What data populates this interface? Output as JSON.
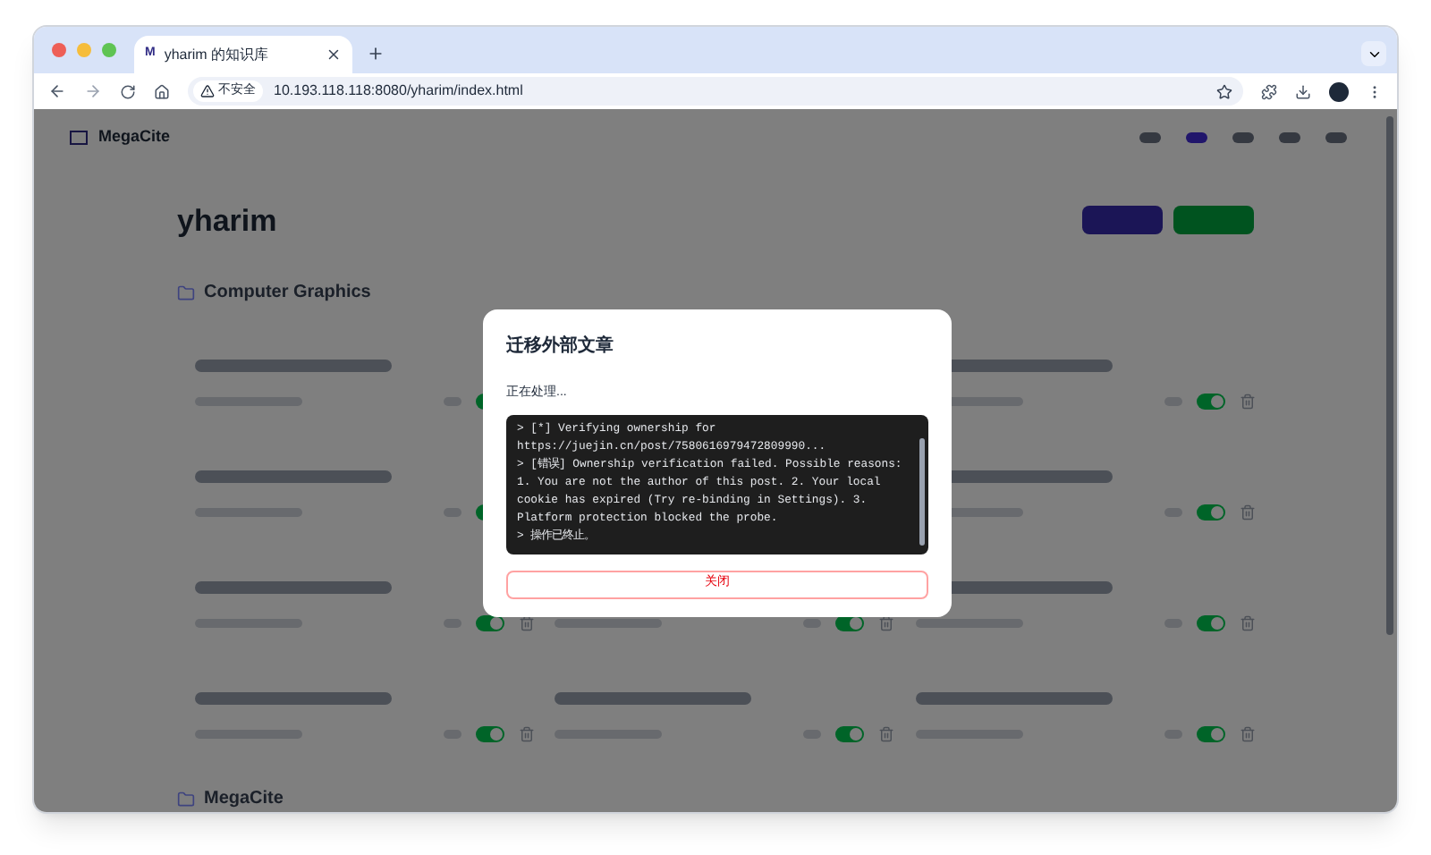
{
  "browser": {
    "tab_icon": "M",
    "tab_title": "yharim 的知识库",
    "security_label": "不安全",
    "url": "10.193.118.118:8080/yharim/index.html"
  },
  "page": {
    "logo": "MegaCite",
    "nav": [
      {
        "selected": false
      },
      {
        "selected": true
      },
      {
        "selected": false
      },
      {
        "selected": false
      },
      {
        "selected": false
      }
    ],
    "title": "yharim",
    "sections": [
      {
        "name": "Computer Graphics"
      },
      {
        "name": "MegaCite"
      }
    ],
    "cards": [
      {
        "on": true
      },
      {
        "on": true
      },
      {
        "on": true
      },
      {
        "on": true
      },
      {
        "on": true
      },
      {
        "on": true
      },
      {
        "on": true
      },
      {
        "on": true
      },
      {
        "on": true
      },
      {
        "on": true
      }
    ]
  },
  "dialog": {
    "title": "迁移外部文章",
    "status": "正在处理...",
    "log": [
      "> [*] Verifying ownership for https://juejin.cn/post/7580616979472809990...",
      "> [错误] Ownership verification failed. Possible reasons: 1. You are not the author of this post. 2. Your local cookie has expired (Try re-binding in Settings). 3. Platform protection blocked the probe.",
      "> 操作已终止。"
    ],
    "close_button": "关闭"
  }
}
